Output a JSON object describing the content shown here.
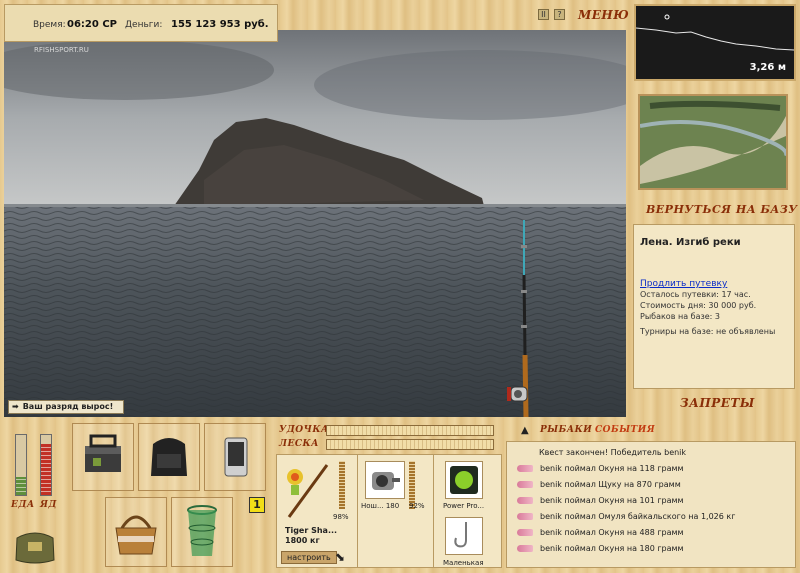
{
  "status_bar": {
    "time_label": "Время:",
    "time_value": "06:20 СР",
    "money_label": "Деньги:",
    "money_value": "155 123 953 руб."
  },
  "view": {
    "watermark": "RFISHSPORT.RU"
  },
  "controls": {
    "pause": "II",
    "help": "?",
    "menu": "МЕНЮ"
  },
  "minimap": {
    "depth": "3,26 м"
  },
  "location": {
    "return_button": "ВЕРНУТЬСЯ НА БАЗУ",
    "title": "Лена. Изгиб реки",
    "extend_link": "Продлить путевку",
    "lines": [
      "Осталось путевки: 17 час.",
      "Стоимость дня: 30 000 руб.",
      "Рыбаков на базе: 3",
      "Турниры на базе: не объявлены"
    ],
    "bans_button": "ЗАПРЕТЫ"
  },
  "notification": {
    "text": "Ваш разряд вырос!"
  },
  "needs": {
    "food_label": "ЕДА",
    "health_label": "ЯД",
    "food_level": 0.3,
    "health_level": 0.85
  },
  "inventory": {
    "badge": "1"
  },
  "tackle": {
    "rod_label": "УДОЧКА",
    "line_label": "ЛЕСКА",
    "rod_name": "Tiger Sha...",
    "rod_load": "1800 кг",
    "rod_pct": "98%",
    "reel_name": "Нош... 180",
    "reel_pct": "92%",
    "line_name": "Power Pro...",
    "hook_name": "Маленькая",
    "setup_button": "настроить"
  },
  "events": {
    "title_a": "РЫБАКИ",
    "title_b": "СОБЫТИЯ",
    "quest": "Квест закончен! Победитель benik",
    "items": [
      "benik поймал Окуня на 118 грамм",
      "benik поймал Щуку на 870 грамм",
      "benik поймал Окуня на 101 грамм",
      "benik поймал Омуля байкальского на 1,026 кг",
      "benik поймал Окуня на 488 грамм",
      "benik поймал Окуня на 180 грамм"
    ]
  }
}
